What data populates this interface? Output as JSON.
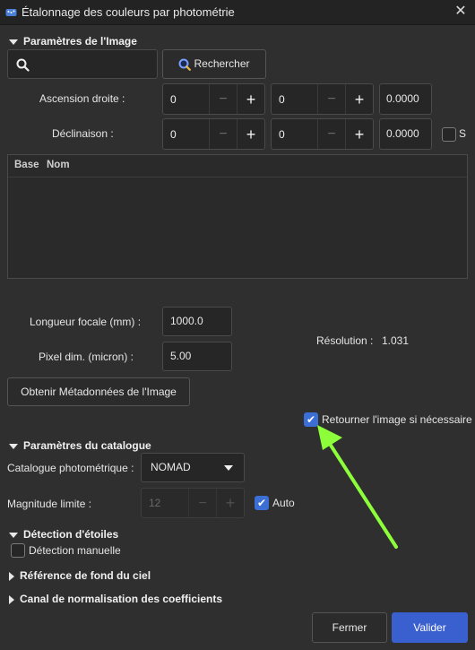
{
  "window": {
    "title": "Étalonnage des couleurs par photométrie",
    "close_glyph": "✕"
  },
  "image_section": {
    "header": "Paramètres de l'Image",
    "search": {
      "value": "",
      "placeholder": "",
      "button_label": "Rechercher"
    },
    "ra": {
      "label": "Ascension droite :",
      "h": "0",
      "m": "0",
      "s": "0.0000"
    },
    "dec": {
      "label": "Déclinaison :",
      "d": "0",
      "m": "0",
      "s": "0.0000",
      "south_label": "S"
    },
    "table": {
      "columns": [
        "Base",
        "Nom"
      ],
      "rows": []
    },
    "focal": {
      "label": "Longueur focale (mm) :",
      "value": "1000.0"
    },
    "pixel": {
      "label": "Pixel dim. (micron) :",
      "value": "5.00"
    },
    "resolution": {
      "label": "Résolution :",
      "value": "1.031"
    },
    "metadata_button": "Obtenir Métadonnées de l'Image",
    "flip_checkbox": {
      "label": "Retourner l'image si nécessaire",
      "checked": true
    }
  },
  "catalog_section": {
    "header": "Paramètres du catalogue",
    "catalog": {
      "label": "Catalogue photométrique :",
      "selected": "NOMAD"
    },
    "magnitude": {
      "label": "Magnitude limite :",
      "value": "12",
      "auto_label": "Auto",
      "auto_checked": true
    }
  },
  "stars_section": {
    "header": "Détection d'étoiles",
    "manual": {
      "label": "Détection manuelle",
      "checked": false
    }
  },
  "sky_section": {
    "header": "Référence de fond du ciel"
  },
  "norm_section": {
    "header": "Canal de normalisation des coefficients"
  },
  "buttons": {
    "close": "Fermer",
    "ok": "Valider"
  },
  "spin_glyphs": {
    "minus": "−",
    "plus": "+"
  },
  "annotation": {
    "arrow_color": "#8cff3a"
  },
  "colors": {
    "accent": "#3a5fcf",
    "checkbox": "#3b6fd6",
    "background": "#2f2f2f"
  }
}
